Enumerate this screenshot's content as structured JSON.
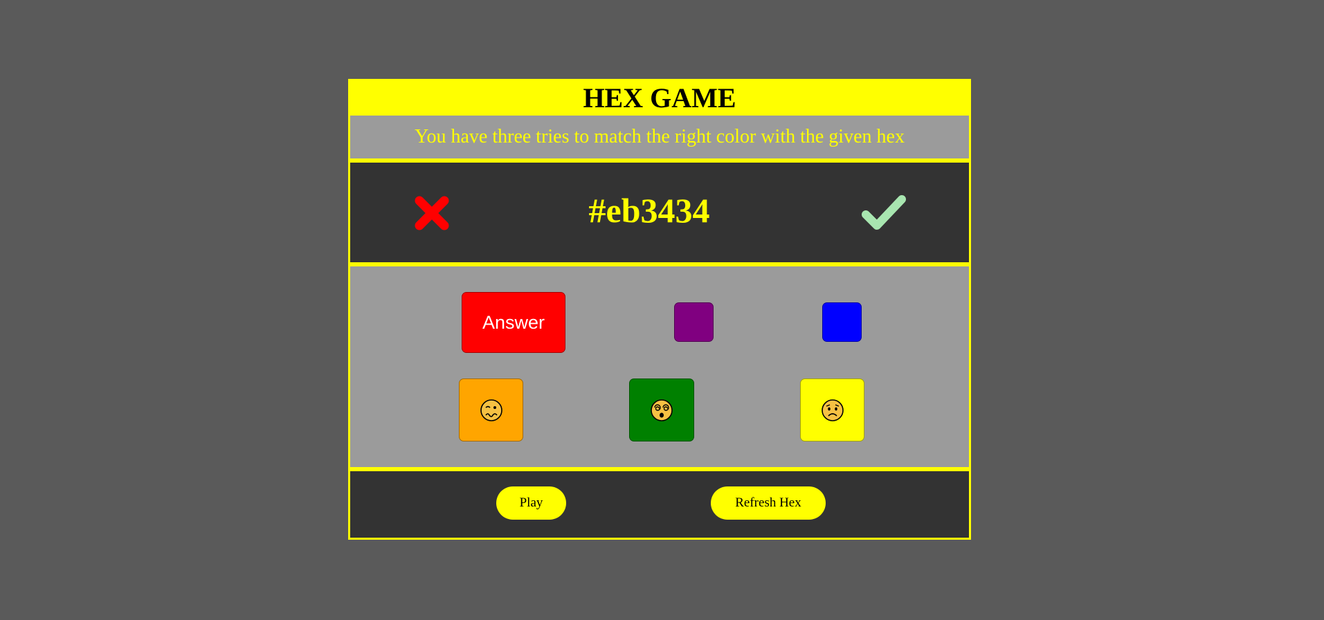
{
  "header": {
    "title": "HEX GAME",
    "instructions": "You have three tries to match the right color with the given hex"
  },
  "status": {
    "hex": "#eb3434",
    "wrong_icon": "x-mark-icon",
    "correct_icon": "check-mark-icon"
  },
  "swatches": [
    {
      "color": "#ff0000",
      "label": "Answer",
      "emoji": ""
    },
    {
      "color": "#800080",
      "label": "",
      "emoji": ""
    },
    {
      "color": "#0000ff",
      "label": "",
      "emoji": ""
    },
    {
      "color": "#ffa500",
      "label": "",
      "emoji": "woozy-face-icon"
    },
    {
      "color": "#008000",
      "label": "",
      "emoji": "dizzy-face-icon"
    },
    {
      "color": "#ffff00",
      "label": "",
      "emoji": "worried-face-icon"
    }
  ],
  "controls": {
    "play_label": "Play",
    "refresh_label": "Refresh Hex"
  },
  "colors": {
    "background": "#5a5a5a",
    "accent": "#ffff00",
    "panel_dark": "#333333",
    "panel_gray": "#9b9b9b",
    "wrong": "#ff0000",
    "correct": "#a8e6b0"
  }
}
